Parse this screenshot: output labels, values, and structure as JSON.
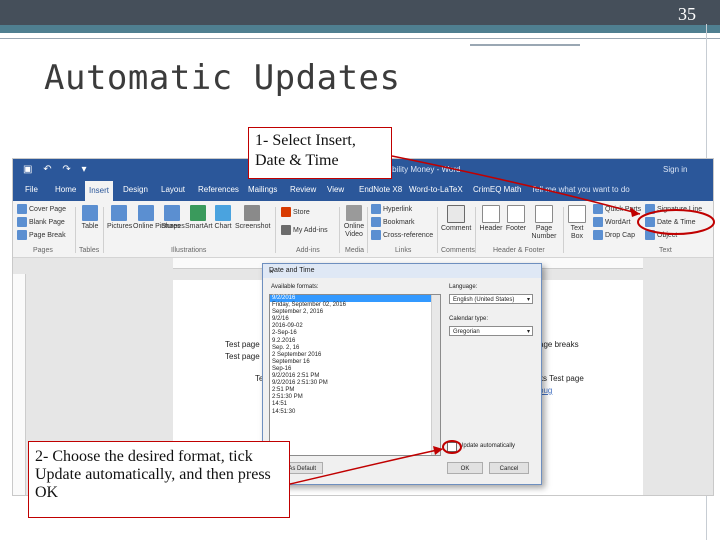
{
  "slide": {
    "number": "35",
    "title": "Automatic Updates"
  },
  "callouts": {
    "step1": "1- Select Insert, Date & Time",
    "step2": "2- Choose the desired format, tick Update automatically, and then press OK"
  },
  "word": {
    "doc_title": "Sustainability Money - Word",
    "sign_in": "Sign in",
    "tabs": [
      "File",
      "Home",
      "Insert",
      "Design",
      "Layout",
      "References",
      "Mailings",
      "Review",
      "View",
      "EndNote X8",
      "Word-to-LaTeX",
      "CrimEQ Math"
    ],
    "tell_me": "Tell me what you want to do",
    "ribbon": {
      "pages": [
        "Cover Page",
        "Blank Page",
        "Page Break"
      ],
      "table": "Table",
      "illustrations": [
        "Pictures",
        "Online Pictures",
        "Shapes",
        "SmartArt",
        "Chart",
        "Screenshot"
      ],
      "addins": [
        "Store",
        "My Add-ins"
      ],
      "media": "Online Video",
      "links": [
        "Hyperlink",
        "Bookmark",
        "Cross-reference"
      ],
      "comment": "Comment",
      "header_footer": [
        "Header",
        "Footer",
        "Page Number"
      ],
      "textbox": "Text Box",
      "text_group": [
        "Quick Parts",
        "WordArt",
        "Drop Cap"
      ],
      "text_right": [
        "Signature Line",
        "Date & Time",
        "Object"
      ],
      "groups": [
        "Pages",
        "Tables",
        "Illustrations",
        "Add-ins",
        "Media",
        "Links",
        "Comments",
        "Header & Footer",
        "Text"
      ]
    },
    "page_text": {
      "line1": "Test page fo",
      "line2": "Test page fo",
      "line3": "Test",
      "line1_right": "age breaks",
      "line3_right": "ks Test page",
      "link": "oug"
    }
  },
  "dialog": {
    "title": "Date and Time",
    "close": "×",
    "formats_label": "Available formats:",
    "formats": [
      "9/2/2016",
      "Friday, September 02, 2016",
      "September 2, 2016",
      "9/2/16",
      "2016-09-02",
      "2-Sep-16",
      "9.2.2016",
      "Sep. 2, 16",
      "2 September 2016",
      "September 16",
      "Sep-16",
      "9/2/2016 2:51 PM",
      "9/2/2016 2:51:30 PM",
      "2:51 PM",
      "2:51:30 PM",
      "14:51",
      "14:51:30"
    ],
    "language_label": "Language:",
    "language_value": "English (United States)",
    "calendar_label": "Calendar type:",
    "calendar_value": "Gregorian",
    "update_label": "Update automatically",
    "default_button": "Set As Default",
    "ok_button": "OK",
    "cancel_button": "Cancel"
  },
  "colors": {
    "word_blue": "#2b579a",
    "callout_border": "#c00000",
    "slide_bar": "#454f5a",
    "slide_accent": "#4f7f90"
  }
}
